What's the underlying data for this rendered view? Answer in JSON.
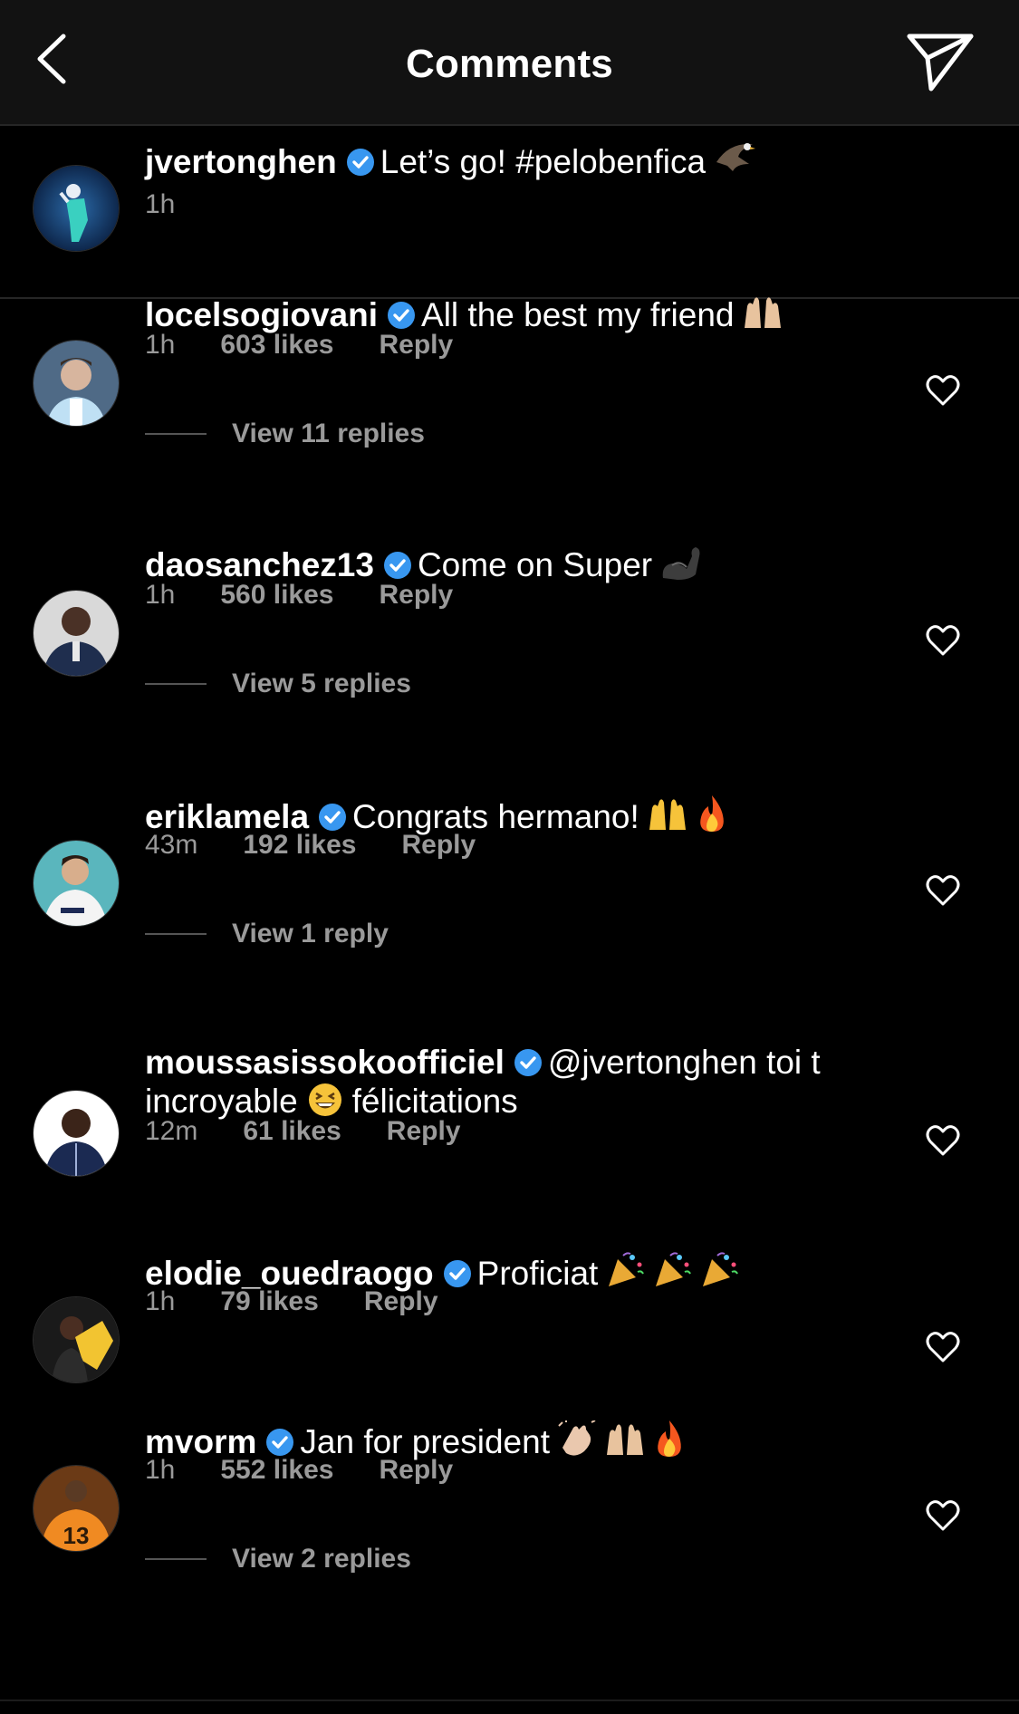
{
  "header": {
    "title": "Comments",
    "back_icon": "chevron-left-icon",
    "send_icon": "paper-plane-icon"
  },
  "colors": {
    "background": "#000000",
    "header_bg": "#121212",
    "text": "#ffffff",
    "secondary_text": "#9a9a9a",
    "verified_blue": "#3897f0"
  },
  "caption": {
    "username": "jvertonghen",
    "text": "Let’s go! #pelobenfica",
    "emoji": "eagle",
    "time": "1h"
  },
  "comments": [
    {
      "username": "locelsogiovani",
      "text": "All the best my friend",
      "emoji": "raised-hands",
      "time": "1h",
      "likes": "603 likes",
      "reply": "Reply",
      "view_replies": "View 11 replies"
    },
    {
      "username": "daosanchez13",
      "text": "Come on Super",
      "emoji": "flexed-biceps",
      "time": "1h",
      "likes": "560 likes",
      "reply": "Reply",
      "view_replies": "View 5 replies"
    },
    {
      "username": "eriklamela",
      "text": "Congrats hermano!",
      "emoji": "raised-hands fire",
      "time": "43m",
      "likes": "192 likes",
      "reply": "Reply",
      "view_replies": "View 1 reply"
    },
    {
      "username": "moussasissokoofficiel",
      "text": "@jvertonghen toi t",
      "text_line2a": "incroyable",
      "text_line2b": "félicitations",
      "emoji": "grinning-squinting-face",
      "time": "12m",
      "likes": "61 likes",
      "reply": "Reply"
    },
    {
      "username": "elodie_ouedraogo",
      "text": "Proficiat",
      "emoji": "party-popper x3",
      "time": "1h",
      "likes": "79 likes",
      "reply": "Reply"
    },
    {
      "username": "mvorm",
      "text": "Jan for president",
      "emoji": "clapping-hands raised-hands fire",
      "time": "1h",
      "likes": "552 likes",
      "reply": "Reply",
      "view_replies": "View 2 replies"
    }
  ]
}
